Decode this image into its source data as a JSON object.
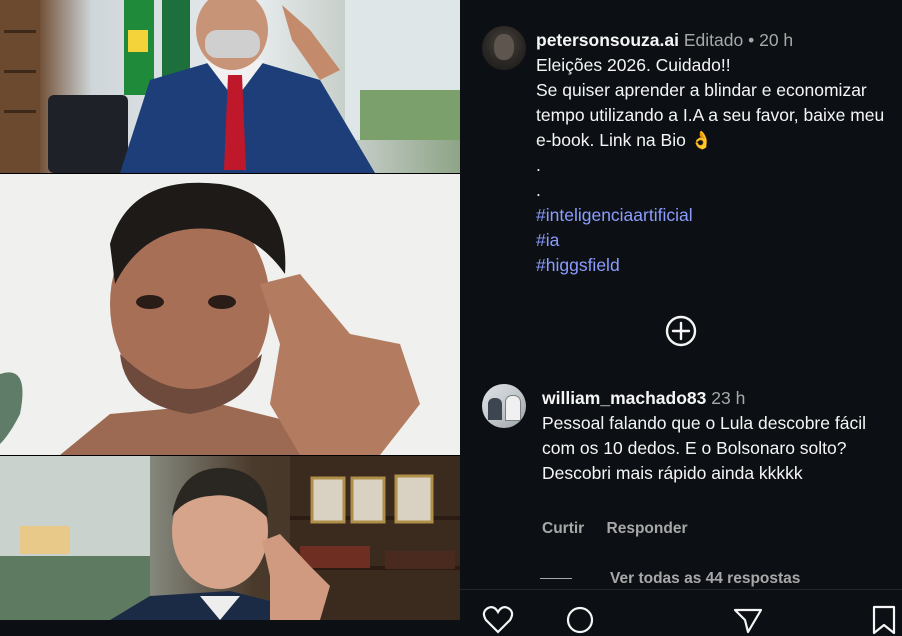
{
  "post": {
    "author": "petersonsouza.ai",
    "edited": "Editado",
    "separator": "•",
    "time": "20 h",
    "caption_lines": [
      "Eleições 2026. Cuidado!!",
      "Se quiser aprender a blindar e economizar tempo utilizando a I.A a seu favor, baixe meu e-book. Link na Bio 👌",
      ".",
      "."
    ],
    "hashtags": [
      "#inteligenciaartificial",
      "#ia",
      "#higgsfield"
    ]
  },
  "comment": {
    "author": "william_machado83",
    "time": "23 h",
    "text": "Pessoal falando que o Lula descobre fácil com os 10 dedos. E o Bolsonaro solto? Descobri mais rápido ainda kkkkk",
    "like_label": "Curtir",
    "reply_label": "Responder",
    "view_replies": "Ver todas as 44 respostas"
  },
  "icons": {
    "add_comment": "plus-circle-icon",
    "bottom_bar": [
      "heart-icon",
      "comment-icon",
      "share-icon",
      "save-icon"
    ]
  },
  "colors": {
    "background": "#0c1014",
    "hashtag": "#8b9cff",
    "secondary_text": "#a8a8a8"
  }
}
